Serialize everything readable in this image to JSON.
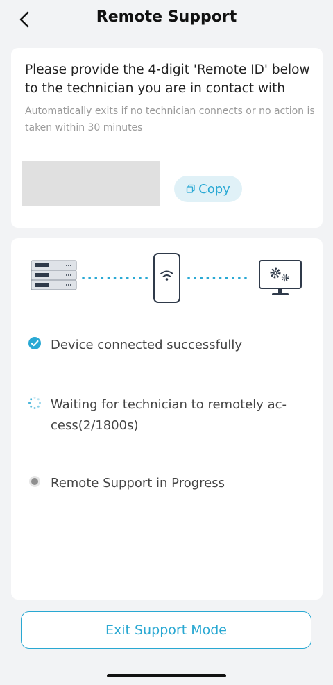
{
  "header": {
    "title": "Remote Support",
    "back_icon": "chevron-left-icon"
  },
  "instructions": {
    "text": "Please provide the 4-digit 'Remote ID' below to the technician you are in contact with",
    "note": "Automatically exits if no technician connects or no action is taken within 30 minutes"
  },
  "remote_id": {
    "value": "",
    "copy_label": "Copy",
    "copy_icon": "copy-icon"
  },
  "diagram": {
    "left_icon": "server-icon",
    "middle_icon": "phone-wifi-icon",
    "right_icon": "monitor-gears-icon",
    "accent_color": "#2aa9d4"
  },
  "steps": [
    {
      "text": "Device connected successfully",
      "state": "done",
      "icon": "check-circle-icon"
    },
    {
      "text": "Waiting for technician to remotely ac-cess(2/1800s)",
      "state": "in-progress",
      "icon": "spinner-icon"
    },
    {
      "text": "Remote Support in Progress",
      "state": "pending",
      "icon": "radio-dot-icon"
    }
  ],
  "exit_button": {
    "label": "Exit Support Mode"
  },
  "colors": {
    "accent": "#2aa9d4",
    "background": "#f2f3f5",
    "card": "#ffffff"
  }
}
